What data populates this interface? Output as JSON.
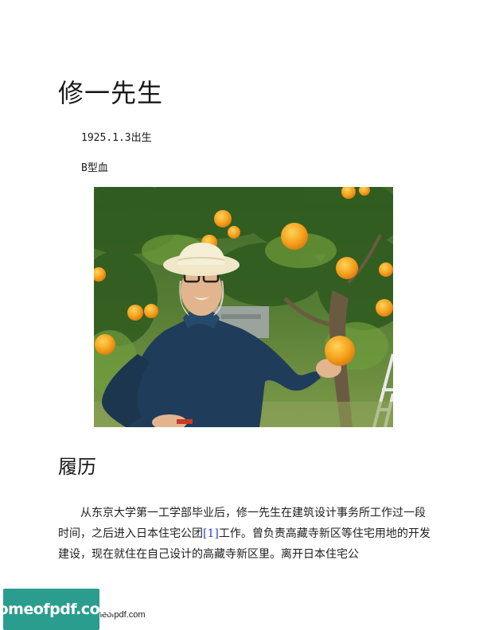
{
  "page": {
    "title": "修一先生",
    "birth": "1925.1.3出生",
    "blood_type": "B型血",
    "photo_alt": "",
    "section_heading": "履历",
    "body_line_1": "从东京大学第一工学部毕业后，修一先生在建筑设计事务所工作过一段时间，之后进入日本住宅公团",
    "footnote_marker": "[1]",
    "body_line_2": "工作。曾负责高藏寺新区等住宅用地的开发建设，现在就住在自己设计的高藏寺新区里。离开日本住宅公"
  },
  "footer": {
    "logo_text": "homeofpdf.com",
    "note": "e please visit: https://homeofpdf.com"
  },
  "colors": {
    "link": "#2a3fd6",
    "logo_bg": "#2a9d8f"
  }
}
